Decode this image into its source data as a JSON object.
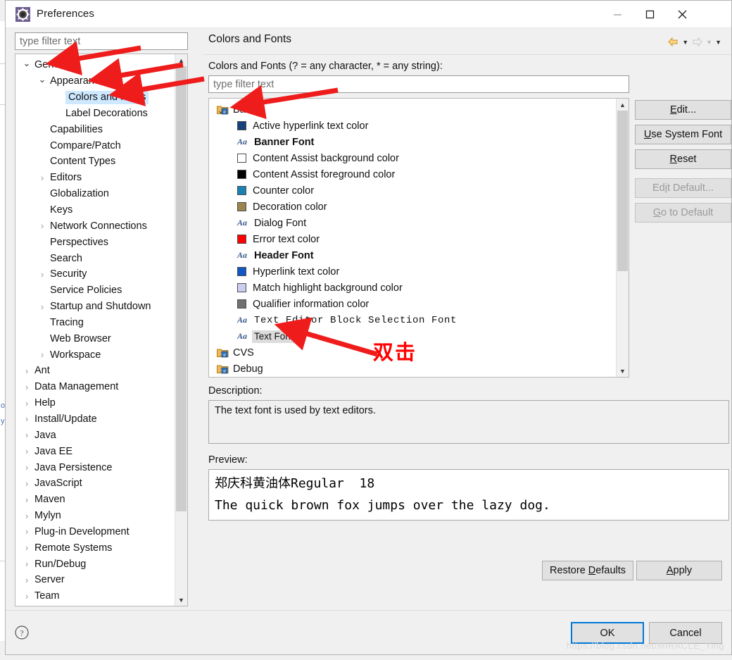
{
  "window": {
    "title": "Preferences",
    "icon": "eclipse-preferences-icon",
    "controls": {
      "minimize": "minimize-icon",
      "maximize": "maximize-icon",
      "close": "close-icon"
    }
  },
  "sidebar": {
    "filter_placeholder": "type filter text",
    "filter_value": "",
    "items": [
      {
        "label": "General",
        "indent": 0,
        "twisty": "down",
        "selected": false
      },
      {
        "label": "Appearance",
        "indent": 1,
        "twisty": "down",
        "selected": false
      },
      {
        "label": "Colors and Fonts",
        "indent": 2,
        "twisty": "none",
        "selected": true
      },
      {
        "label": "Label Decorations",
        "indent": 2,
        "twisty": "none",
        "selected": false
      },
      {
        "label": "Capabilities",
        "indent": 1,
        "twisty": "none",
        "selected": false
      },
      {
        "label": "Compare/Patch",
        "indent": 1,
        "twisty": "none",
        "selected": false
      },
      {
        "label": "Content Types",
        "indent": 1,
        "twisty": "none",
        "selected": false
      },
      {
        "label": "Editors",
        "indent": 1,
        "twisty": "right",
        "selected": false
      },
      {
        "label": "Globalization",
        "indent": 1,
        "twisty": "none",
        "selected": false
      },
      {
        "label": "Keys",
        "indent": 1,
        "twisty": "none",
        "selected": false
      },
      {
        "label": "Network Connections",
        "indent": 1,
        "twisty": "right",
        "selected": false
      },
      {
        "label": "Perspectives",
        "indent": 1,
        "twisty": "none",
        "selected": false
      },
      {
        "label": "Search",
        "indent": 1,
        "twisty": "none",
        "selected": false
      },
      {
        "label": "Security",
        "indent": 1,
        "twisty": "right",
        "selected": false
      },
      {
        "label": "Service Policies",
        "indent": 1,
        "twisty": "none",
        "selected": false
      },
      {
        "label": "Startup and Shutdown",
        "indent": 1,
        "twisty": "right",
        "selected": false
      },
      {
        "label": "Tracing",
        "indent": 1,
        "twisty": "none",
        "selected": false
      },
      {
        "label": "Web Browser",
        "indent": 1,
        "twisty": "none",
        "selected": false
      },
      {
        "label": "Workspace",
        "indent": 1,
        "twisty": "right",
        "selected": false
      },
      {
        "label": "Ant",
        "indent": 0,
        "twisty": "right",
        "selected": false
      },
      {
        "label": "Data Management",
        "indent": 0,
        "twisty": "right",
        "selected": false
      },
      {
        "label": "Help",
        "indent": 0,
        "twisty": "right",
        "selected": false
      },
      {
        "label": "Install/Update",
        "indent": 0,
        "twisty": "right",
        "selected": false
      },
      {
        "label": "Java",
        "indent": 0,
        "twisty": "right",
        "selected": false
      },
      {
        "label": "Java EE",
        "indent": 0,
        "twisty": "right",
        "selected": false
      },
      {
        "label": "Java Persistence",
        "indent": 0,
        "twisty": "right",
        "selected": false
      },
      {
        "label": "JavaScript",
        "indent": 0,
        "twisty": "right",
        "selected": false
      },
      {
        "label": "Maven",
        "indent": 0,
        "twisty": "right",
        "selected": false
      },
      {
        "label": "Mylyn",
        "indent": 0,
        "twisty": "right",
        "selected": false
      },
      {
        "label": "Plug-in Development",
        "indent": 0,
        "twisty": "right",
        "selected": false
      },
      {
        "label": "Remote Systems",
        "indent": 0,
        "twisty": "right",
        "selected": false
      },
      {
        "label": "Run/Debug",
        "indent": 0,
        "twisty": "right",
        "selected": false
      },
      {
        "label": "Server",
        "indent": 0,
        "twisty": "right",
        "selected": false
      },
      {
        "label": "Team",
        "indent": 0,
        "twisty": "right",
        "selected": false
      }
    ]
  },
  "page": {
    "title": "Colors and Fonts",
    "nav_icons": [
      "back-arrow-icon",
      "back-dropdown-caret",
      "forward-arrow-icon",
      "forward-dropdown-caret",
      "view-menu-caret"
    ],
    "filter_label": "Colors and Fonts (? = any character, * = any string):",
    "filter_placeholder": "type filter text",
    "filter_value": "",
    "tree": [
      {
        "kind": "group",
        "label": "Basic",
        "twisty": "down",
        "icon": "folder-font-icon"
      },
      {
        "kind": "color",
        "label": "Active hyperlink text color",
        "color": "#16417c"
      },
      {
        "kind": "font",
        "label": "Banner Font",
        "style": "banner"
      },
      {
        "kind": "color",
        "label": "Content Assist background color",
        "color": "#ffffff"
      },
      {
        "kind": "color",
        "label": "Content Assist foreground color",
        "color": "#000000"
      },
      {
        "kind": "color",
        "label": "Counter color",
        "color": "#1b80b2"
      },
      {
        "kind": "color",
        "label": "Decoration color",
        "color": "#9b8450"
      },
      {
        "kind": "font",
        "label": "Dialog Font",
        "style": "normal"
      },
      {
        "kind": "color",
        "label": "Error text color",
        "color": "#fc0000"
      },
      {
        "kind": "font",
        "label": "Header Font",
        "style": "header"
      },
      {
        "kind": "color",
        "label": "Hyperlink text color",
        "color": "#1257c4"
      },
      {
        "kind": "color",
        "label": "Match highlight background color",
        "color": "#cdcdf4"
      },
      {
        "kind": "color",
        "label": "Qualifier information color",
        "color": "#707070"
      },
      {
        "kind": "font",
        "label": "Text Editor Block Selection Font",
        "style": "mono"
      },
      {
        "kind": "font",
        "label": "Text Font",
        "style": "small",
        "selected": true
      },
      {
        "kind": "group",
        "label": "CVS",
        "twisty": "right",
        "icon": "folder-font-icon"
      },
      {
        "kind": "group",
        "label": "Debug",
        "twisty": "right",
        "icon": "folder-font-icon"
      }
    ],
    "side_buttons": [
      {
        "label": "Edit...",
        "mnemonic": "E",
        "enabled": true
      },
      {
        "label": "Use System Font",
        "mnemonic": "U",
        "enabled": true
      },
      {
        "label": "Reset",
        "mnemonic": "R",
        "enabled": true
      },
      {
        "label": "Edit Default...",
        "mnemonic": "i",
        "enabled": false
      },
      {
        "label": "Go to Default",
        "mnemonic": "G",
        "enabled": false
      }
    ],
    "description_label": "Description:",
    "description_text": "The text font is used by text editors.",
    "preview_label": "Preview:",
    "preview_lines": [
      "郑庆科黄油体Regular  18",
      "The quick brown fox jumps over the lazy dog."
    ],
    "restore_defaults_label": "Restore Defaults",
    "apply_label": "Apply"
  },
  "footer": {
    "help_icon": "help-question-icon",
    "ok_label": "OK",
    "cancel_label": "Cancel",
    "watermark": "https://blog.csdn.net/MIRACLE_Ying"
  },
  "annotations": {
    "chinese_note": "双击",
    "arrow_color": "#ef1c1c",
    "arrows": [
      "arrow-to-general",
      "arrow-to-appearance",
      "arrow-to-colors-and-fonts",
      "arrow-to-basic",
      "arrow-to-filter",
      "arrow-to-text-font"
    ]
  }
}
